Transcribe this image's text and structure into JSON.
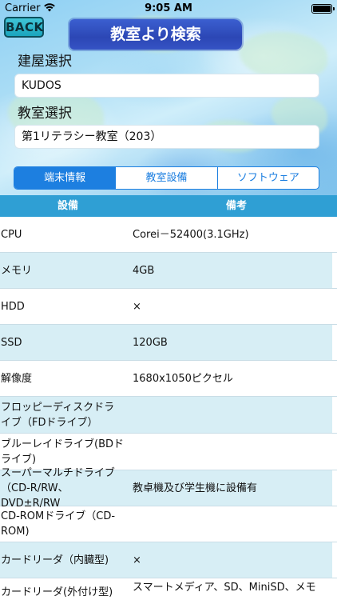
{
  "status_bar": {
    "carrier": "Carrier",
    "time": "9:05 AM"
  },
  "back_label": "BACK",
  "title": "教室より検索",
  "building": {
    "label": "建屋選択",
    "value": "KUDOS"
  },
  "room": {
    "label": "教室選択",
    "value": "第1リテラシー教室（203）"
  },
  "tabs": [
    {
      "label": "端末情報",
      "active": true
    },
    {
      "label": "教室設備",
      "active": false
    },
    {
      "label": "ソフトウェア",
      "active": false
    }
  ],
  "table": {
    "columns": [
      "設備",
      "備考"
    ],
    "rows": [
      {
        "item": "CPU",
        "note": "Corei－52400(3.1GHz)"
      },
      {
        "item": "メモリ",
        "note": "4GB"
      },
      {
        "item": "HDD",
        "note": "×"
      },
      {
        "item": "SSD",
        "note": "120GB"
      },
      {
        "item": "解像度",
        "note": "1680x1050ピクセル"
      },
      {
        "item": "フロッピーディスクドライブ（FDドライブ）",
        "note": ""
      },
      {
        "item": "ブルーレイドライブ(BDドライブ)",
        "note": ""
      },
      {
        "item": "スーパーマルチドライブ（CD-R/RW、DVD±R/RW",
        "note": "教卓機及び学生機に設備有"
      },
      {
        "item": "CD-ROMドライブ（CD-ROM)",
        "note": ""
      },
      {
        "item": "カードリーダ（内臓型)",
        "note": "×"
      },
      {
        "item": "カードリーダ(外付け型)",
        "note": "スマートメディア、SD、MiniSD、メモ"
      }
    ]
  },
  "colors": {
    "segment_accent": "#1d7fe0",
    "table_header": "#2f9fd4",
    "alt_row": "#d7eef5",
    "title_banner": "#2c47b5",
    "back_button": "#1aa5bd"
  }
}
